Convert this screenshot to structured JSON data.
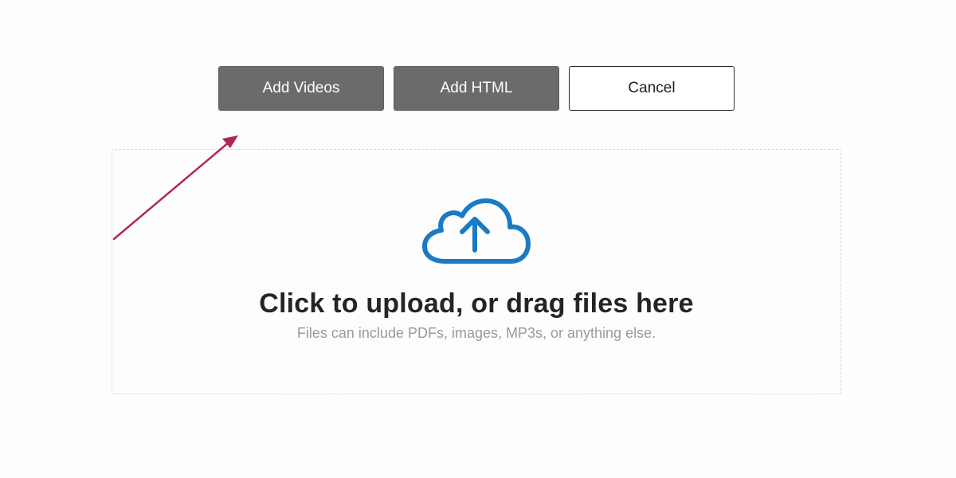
{
  "toolbar": {
    "add_videos_label": "Add Videos",
    "add_html_label": "Add HTML",
    "cancel_label": "Cancel"
  },
  "dropzone": {
    "title": "Click to upload, or drag files here",
    "subtitle": "Files can include PDFs, images, MP3s, or anything else.",
    "icon": "cloud-upload-icon"
  },
  "colors": {
    "primary_button": "#6b6b6b",
    "icon_blue": "#1a7bc4",
    "annotation_arrow": "#b0275a"
  }
}
